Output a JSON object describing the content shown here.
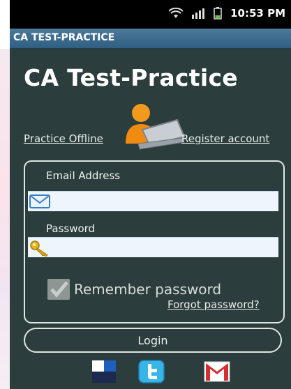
{
  "status_bar": {
    "time": "10:53 PM",
    "icons": [
      "wifi-icon",
      "signal-icon",
      "battery-icon"
    ]
  },
  "title_bar": {
    "title": "CA TEST-PRACTICE"
  },
  "main": {
    "app_title": "CA Test-Practice",
    "practice_offline": "Practice Offline",
    "register_account": "Register account",
    "email_label": "Email Address",
    "email_value": "",
    "password_label": "Password",
    "password_value": "",
    "remember_label": "Remember password",
    "remember_checked": true,
    "forgot_password": "Forgot password?",
    "login_label": "Login",
    "social": [
      "delicious-icon",
      "twitter-icon",
      "gmail-icon"
    ]
  },
  "colors": {
    "background": "#2b3d3c",
    "title_bar": "#3d6a8d",
    "field_bg": "#eef6fc",
    "text": "#ffffff"
  }
}
